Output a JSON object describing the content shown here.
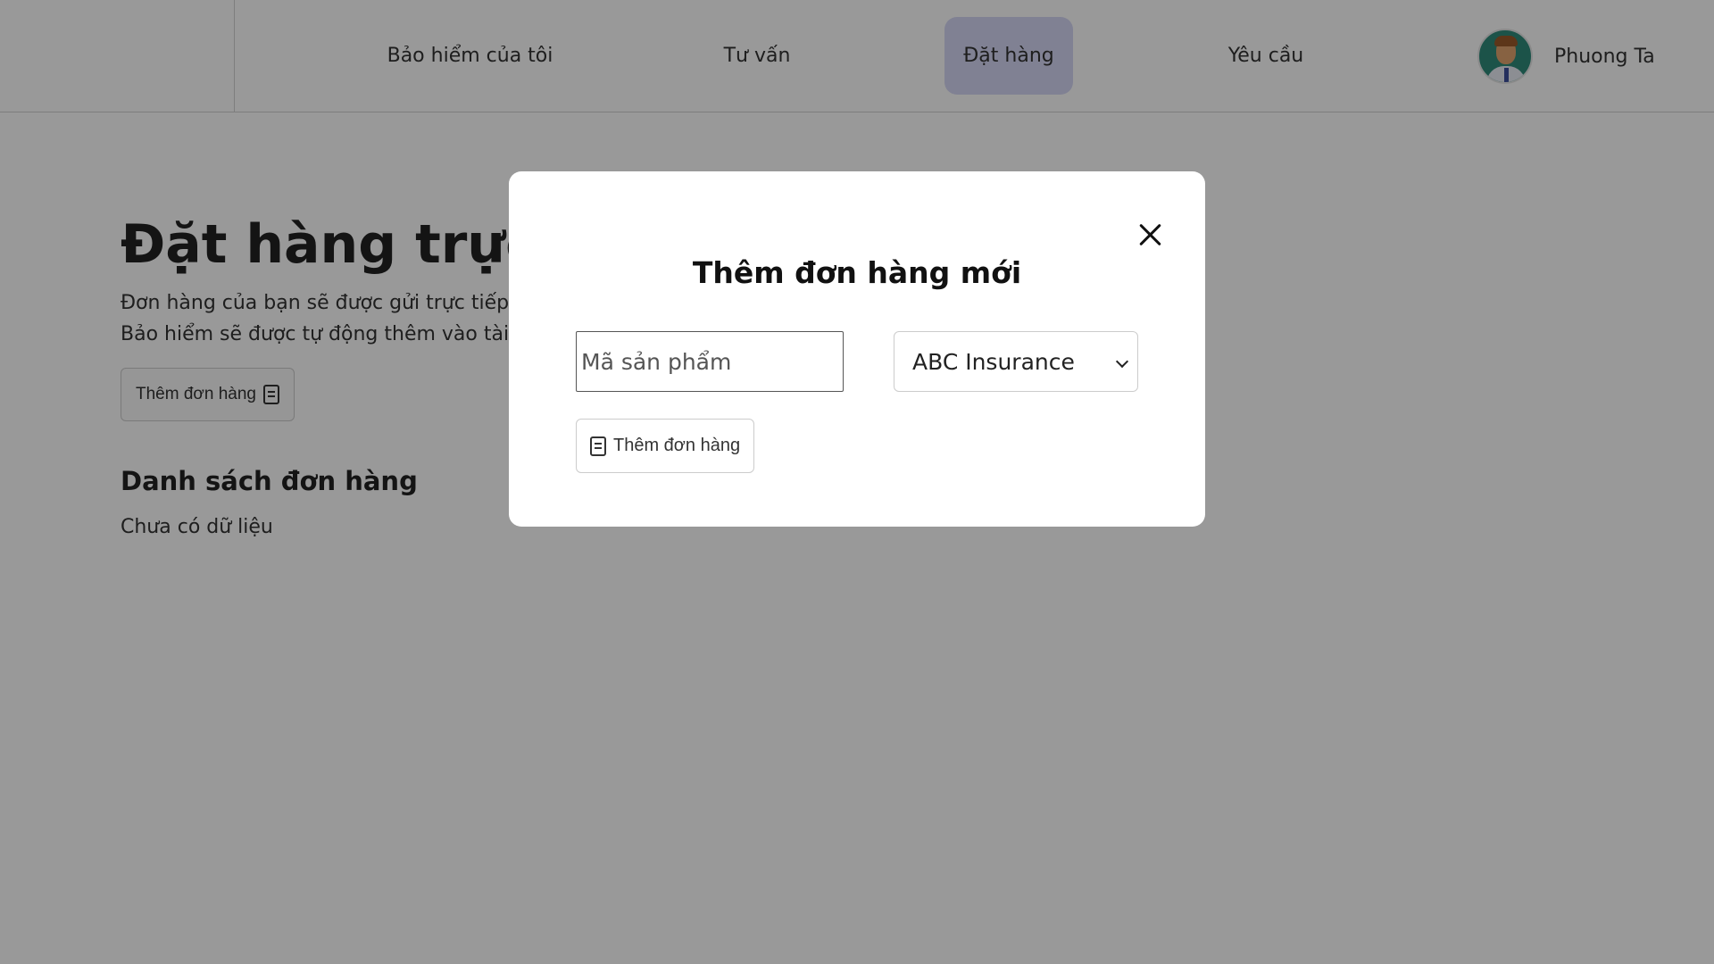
{
  "header": {
    "nav": [
      {
        "label": "Bảo hiểm của tôi",
        "active": false
      },
      {
        "label": "Tư vấn",
        "active": false
      },
      {
        "label": "Đặt hàng",
        "active": true
      },
      {
        "label": "Yêu cầu",
        "active": false
      }
    ],
    "user": {
      "name": "Phuong Ta",
      "avatar_icon": "user-avatar"
    }
  },
  "main": {
    "title": "Đặt hàng trực tuyến",
    "desc_line1": "Đơn hàng của bạn sẽ được gửi trực tiếp",
    "desc_line2": "Bảo hiểm sẽ được tự động thêm vào tài khoản của bạn sau khi xác nhận với công ty bảo hiểm.",
    "add_button_label": "Thêm đơn hàng",
    "add_button_icon": "document-icon",
    "list_title": "Danh sách đơn hàng",
    "empty_text": "Chưa có dữ liệu"
  },
  "modal": {
    "title": "Thêm đơn hàng mới",
    "product_input": {
      "placeholder": "Mã sản phẩm",
      "value": ""
    },
    "insurer_select": {
      "selected": "ABC Insurance"
    },
    "submit_label": "Thêm đơn hàng",
    "submit_icon": "document-icon",
    "close_icon": "close-icon"
  },
  "colors": {
    "active_nav_bg": "#d6d8f5",
    "overlay": "rgba(0,0,0,0.40)"
  }
}
